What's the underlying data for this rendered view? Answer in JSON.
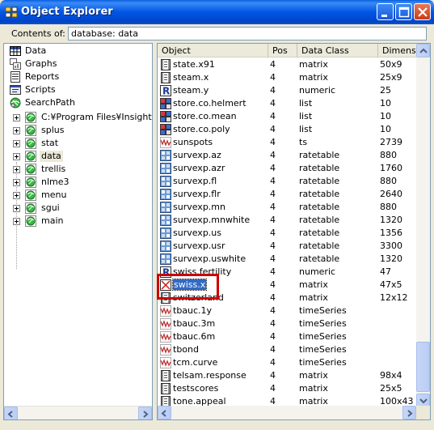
{
  "window": {
    "title": "Object Explorer"
  },
  "contents": {
    "label": "Contents of:",
    "value": "database: data"
  },
  "tree": {
    "items": [
      {
        "label": "Data",
        "icon": "data-grid-icon"
      },
      {
        "label": "Graphs",
        "icon": "graphs-icon"
      },
      {
        "label": "Reports",
        "icon": "reports-icon"
      },
      {
        "label": "Scripts",
        "icon": "scripts-icon"
      },
      {
        "label": "SearchPath",
        "icon": "searchpath-icon"
      },
      {
        "label": "C:¥Program Files¥Insightful",
        "icon": "database-icon"
      },
      {
        "label": "splus",
        "icon": "database-icon"
      },
      {
        "label": "stat",
        "icon": "database-icon"
      },
      {
        "label": "data",
        "icon": "database-icon"
      },
      {
        "label": "trellis",
        "icon": "database-icon"
      },
      {
        "label": "nlme3",
        "icon": "database-icon"
      },
      {
        "label": "menu",
        "icon": "database-icon"
      },
      {
        "label": "sgui",
        "icon": "database-icon"
      },
      {
        "label": "main",
        "icon": "database-icon"
      }
    ]
  },
  "table": {
    "columns": [
      "Object",
      "Pos",
      "Data Class",
      "Dimension"
    ],
    "rows": [
      {
        "name": "state.x91",
        "pos": "4",
        "cls": "matrix",
        "dim": "50x9",
        "icon": "matrix-icon"
      },
      {
        "name": "steam.x",
        "pos": "4",
        "cls": "matrix",
        "dim": "25x9",
        "icon": "matrix-icon"
      },
      {
        "name": "steam.y",
        "pos": "4",
        "cls": "numeric",
        "dim": "25",
        "icon": "numeric-icon"
      },
      {
        "name": "store.co.helmert",
        "pos": "4",
        "cls": "list",
        "dim": "10",
        "icon": "list-icon"
      },
      {
        "name": "store.co.mean",
        "pos": "4",
        "cls": "list",
        "dim": "10",
        "icon": "list-icon"
      },
      {
        "name": "store.co.poly",
        "pos": "4",
        "cls": "list",
        "dim": "10",
        "icon": "list-icon"
      },
      {
        "name": "sunspots",
        "pos": "4",
        "cls": "ts",
        "dim": "2739",
        "icon": "timeseries-icon"
      },
      {
        "name": "survexp.az",
        "pos": "4",
        "cls": "ratetable",
        "dim": "880",
        "icon": "ratetable-icon"
      },
      {
        "name": "survexp.azr",
        "pos": "4",
        "cls": "ratetable",
        "dim": "1760",
        "icon": "ratetable-icon"
      },
      {
        "name": "survexp.fl",
        "pos": "4",
        "cls": "ratetable",
        "dim": "880",
        "icon": "ratetable-icon"
      },
      {
        "name": "survexp.flr",
        "pos": "4",
        "cls": "ratetable",
        "dim": "2640",
        "icon": "ratetable-icon"
      },
      {
        "name": "survexp.mn",
        "pos": "4",
        "cls": "ratetable",
        "dim": "880",
        "icon": "ratetable-icon"
      },
      {
        "name": "survexp.mnwhite",
        "pos": "4",
        "cls": "ratetable",
        "dim": "1320",
        "icon": "ratetable-icon"
      },
      {
        "name": "survexp.us",
        "pos": "4",
        "cls": "ratetable",
        "dim": "1356",
        "icon": "ratetable-icon"
      },
      {
        "name": "survexp.usr",
        "pos": "4",
        "cls": "ratetable",
        "dim": "3300",
        "icon": "ratetable-icon"
      },
      {
        "name": "survexp.uswhite",
        "pos": "4",
        "cls": "ratetable",
        "dim": "1320",
        "icon": "ratetable-icon"
      },
      {
        "name": "swiss.fertility",
        "pos": "4",
        "cls": "numeric",
        "dim": "47",
        "icon": "numeric-icon"
      },
      {
        "name": "swiss.x",
        "pos": "4",
        "cls": "matrix",
        "dim": "47x5",
        "icon": "matrix-x-icon"
      },
      {
        "name": "switzerland",
        "pos": "4",
        "cls": "matrix",
        "dim": "12x12",
        "icon": "matrix-icon"
      },
      {
        "name": "tbauc.1y",
        "pos": "4",
        "cls": "timeSeries",
        "dim": "",
        "icon": "timeseries-icon"
      },
      {
        "name": "tbauc.3m",
        "pos": "4",
        "cls": "timeSeries",
        "dim": "",
        "icon": "timeseries-icon"
      },
      {
        "name": "tbauc.6m",
        "pos": "4",
        "cls": "timeSeries",
        "dim": "",
        "icon": "timeseries-icon"
      },
      {
        "name": "tbond",
        "pos": "4",
        "cls": "timeSeries",
        "dim": "",
        "icon": "timeseries-icon"
      },
      {
        "name": "tcm.curve",
        "pos": "4",
        "cls": "timeSeries",
        "dim": "",
        "icon": "timeseries-icon"
      },
      {
        "name": "telsam.response",
        "pos": "4",
        "cls": "matrix",
        "dim": "98x4",
        "icon": "matrix-icon"
      },
      {
        "name": "testscores",
        "pos": "4",
        "cls": "matrix",
        "dim": "25x5",
        "icon": "matrix-icon"
      },
      {
        "name": "tone.appeal",
        "pos": "4",
        "cls": "matrix",
        "dim": "100x43",
        "icon": "matrix-icon"
      }
    ],
    "selected_index": 17
  }
}
